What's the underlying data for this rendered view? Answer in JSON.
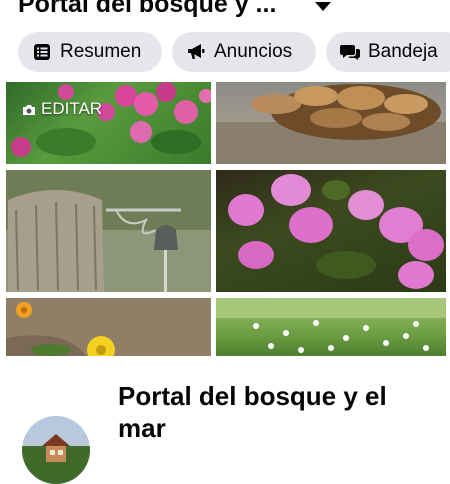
{
  "header": {
    "title": "Portal del bosque y ...",
    "caret_icon": "caret-down-icon"
  },
  "chips": [
    {
      "label": "Resumen",
      "icon": "list-icon"
    },
    {
      "label": "Anuncios",
      "icon": "megaphone-icon"
    },
    {
      "label": "Bandeja",
      "icon": "chat-bubbles-icon"
    }
  ],
  "cover": {
    "edit_label": "EDITAR",
    "edit_icon": "camera-icon",
    "photos": [
      {
        "name": "pink-flowers-photo"
      },
      {
        "name": "pine-cone-photo"
      },
      {
        "name": "wooden-post-bell-photo"
      },
      {
        "name": "azalea-photo"
      },
      {
        "name": "tree-trunk-yellow-flowers-photo"
      },
      {
        "name": "daisy-lawn-photo"
      }
    ]
  },
  "profile": {
    "name": "Portal del bosque y el mar"
  },
  "colors": {
    "chip_bg": "#e4e6eb",
    "text": "#050505",
    "background": "#ffffff"
  }
}
